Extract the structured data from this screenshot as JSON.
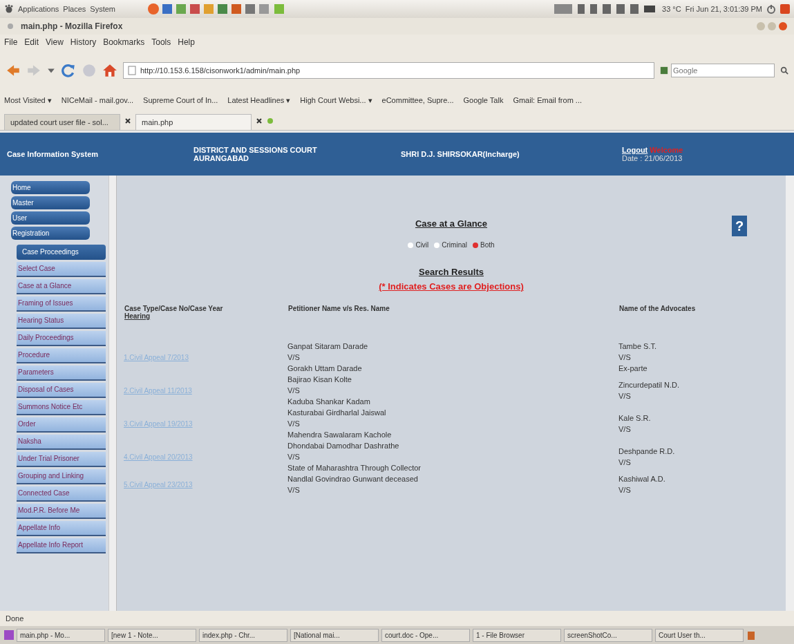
{
  "top_panel": {
    "menus": [
      "Applications",
      "Places",
      "System"
    ],
    "weather": "33 °C",
    "clock": "Fri Jun 21, 3:01:39 PM"
  },
  "window": {
    "title": "main.php - Mozilla Firefox"
  },
  "menu_bar": [
    "File",
    "Edit",
    "View",
    "History",
    "Bookmarks",
    "Tools",
    "Help"
  ],
  "address": {
    "value": "http://10.153.6.158/cisonwork1/admin/main.php"
  },
  "search": {
    "placeholder": "Google"
  },
  "bookmarks": [
    "Most Visited ▾",
    "NICeMail - mail.gov...",
    "Supreme Court of In...",
    "Latest Headlines ▾",
    "High Court Websi... ▾",
    "eCommittee, Supre...",
    "Google Talk",
    "Gmail: Email from ..."
  ],
  "tabs": [
    {
      "label": "updated court user file - sol...",
      "selected": false
    },
    {
      "label": "main.php",
      "selected": true
    }
  ],
  "header": {
    "app": "Case Information System",
    "court": [
      "DISTRICT AND SESSIONS COURT",
      "AURANGABAD"
    ],
    "user": "SHRI D.J. SHIRSOKAR(Incharge)",
    "logout": "Logout",
    "status": "Welcome",
    "date": "Date : 21/06/2013"
  },
  "sidebar": {
    "menus": [
      "Home",
      "Master",
      "User",
      "Registration"
    ],
    "submenu": "Case Proceedings",
    "items": [
      "Select Case",
      "Case at a Glance",
      "Framing of Issues",
      "Hearing Status",
      "Daily Proceedings",
      "Procedure",
      "Parameters",
      "Disposal of Cases",
      "Summons Notice Etc",
      "Order",
      "Naksha",
      "Under Trial Prisoner",
      "Grouping and Linking",
      "Connected Case",
      "Mod.P.R. Before Me",
      "Appellate Info",
      "Appellate Info Report"
    ]
  },
  "page": {
    "title": "Case at a Glance",
    "options": [
      {
        "label": "Civil",
        "selected": false
      },
      {
        "label": "Criminal",
        "selected": false
      },
      {
        "label": "Both",
        "selected": true
      }
    ],
    "help": "?",
    "results_title": "Search Results",
    "note": "(* Indicates Cases are Objections)"
  },
  "table": {
    "columns": [
      {
        "label": "Case Type/Case No/Case Year",
        "sub": "Hearing"
      },
      {
        "label": "Petitioner Name v/s Res. Name"
      },
      {
        "label": "Name of the Advocates"
      }
    ],
    "rows": [
      {
        "case": "1.Civil Appeal 7/2013",
        "petitioner": "Ganpat Sitaram Darade",
        "vs": "V/S",
        "respondent": "Gorakh Uttam Darade",
        "adv_petitioner": "Tambe S.T.",
        "adv_vs": "V/S",
        "adv_respondent": "Ex-parte"
      },
      {
        "case": "2.Civil Appeal 11/2013",
        "petitioner": "Bajirao Kisan Kolte",
        "vs": "V/S",
        "respondent": "Kaduba Shankar Kadam",
        "adv_petitioner": "Zincurdepatil N.D.",
        "adv_vs": "V/S"
      },
      {
        "case": "3.Civil Appeal 19/2013",
        "petitioner": "Kasturabai Girdharlal Jaiswal",
        "vs": "V/S",
        "respondent": "Mahendra Sawalaram Kachole",
        "adv_petitioner": "Kale S.R.",
        "adv_vs": "V/S"
      },
      {
        "case": "4.Civil Appeal 20/2013",
        "petitioner": "Dhondabai Damodhar Dashrathe",
        "vs": "V/S",
        "respondent": "State of Maharashtra Through Collector",
        "adv_petitioner": "Deshpande R.D.",
        "adv_vs": "V/S"
      },
      {
        "case": "5.Civil Appeal 23/2013",
        "petitioner": "Nandlal Govindrao Gunwant deceased",
        "vs": "V/S",
        "adv_petitioner": "Kashiwal A.D.",
        "adv_vs": "V/S"
      }
    ]
  },
  "status_bar": "Done",
  "taskbar": [
    "main.php - Mo...",
    "[new 1 - Note...",
    "index.php - Chr...",
    "[National mai...",
    "court.doc - Ope...",
    "1 - File Browser",
    "screenShotCo...",
    "Court User th..."
  ]
}
